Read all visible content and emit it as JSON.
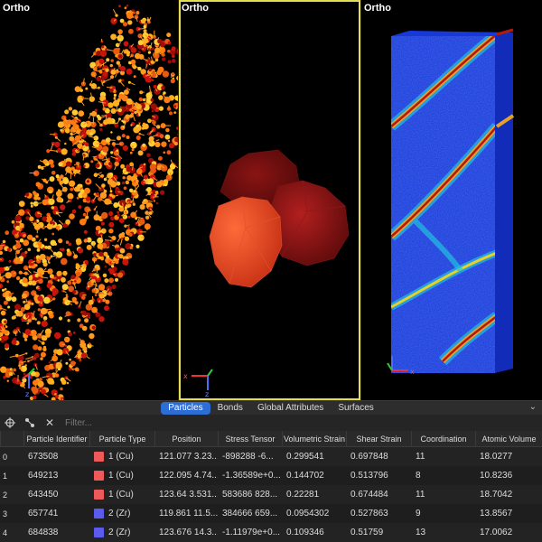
{
  "viewports": [
    {
      "label": "Ortho"
    },
    {
      "label": "Ortho"
    },
    {
      "label": "Ortho"
    }
  ],
  "tabs": [
    "Particles",
    "Bonds",
    "Global Attributes",
    "Surfaces"
  ],
  "active_tab": "Particles",
  "filter_placeholder": "Filter...",
  "columns": [
    "Particle Identifier",
    "Particle Type",
    "Position",
    "Stress Tensor",
    "Volumetric Strain",
    "Shear Strain",
    "Coordination",
    "Atomic Volume"
  ],
  "rows": [
    {
      "index": "0",
      "id": "673508",
      "type": "1 (Cu)",
      "type_color": "#ee5a5a",
      "position": "121.077 3.23...",
      "stress": "-898288 -6...",
      "vol_strain": "0.299541",
      "shear_strain": "0.697848",
      "coordination": "11",
      "atomic_volume": "18.0277"
    },
    {
      "index": "1",
      "id": "649213",
      "type": "1 (Cu)",
      "type_color": "#ee5a5a",
      "position": "122.095 4.74...",
      "stress": "-1.36589e+0...",
      "vol_strain": "0.144702",
      "shear_strain": "0.513796",
      "coordination": "8",
      "atomic_volume": "10.8236"
    },
    {
      "index": "2",
      "id": "643450",
      "type": "1 (Cu)",
      "type_color": "#ee5a5a",
      "position": "123.64 3.531...",
      "stress": "583686 828...",
      "vol_strain": "0.22281",
      "shear_strain": "0.674484",
      "coordination": "11",
      "atomic_volume": "18.7042"
    },
    {
      "index": "3",
      "id": "657741",
      "type": "2 (Zr)",
      "type_color": "#5b5bee",
      "position": "119.861 11.5...",
      "stress": "384666 659...",
      "vol_strain": "0.0954302",
      "shear_strain": "0.527863",
      "coordination": "9",
      "atomic_volume": "13.8567"
    },
    {
      "index": "4",
      "id": "684838",
      "type": "2 (Zr)",
      "type_color": "#5b5bee",
      "position": "123.676 14.3...",
      "stress": "-1.11979e+0...",
      "vol_strain": "0.109346",
      "shear_strain": "0.51759",
      "coordination": "13",
      "atomic_volume": "17.0062"
    }
  ],
  "axis_labels": {
    "x": "x",
    "z": "z"
  },
  "icons": {
    "pick": "crosshair-icon",
    "inspect": "bond-icon",
    "clear": "close-icon",
    "collapse": "chevron-down-icon"
  },
  "colors": {
    "active_tab": "#2d6dd6",
    "viewport_border": "#e7dd52",
    "cu": "#ee5a5a",
    "zr": "#5b5bee"
  }
}
